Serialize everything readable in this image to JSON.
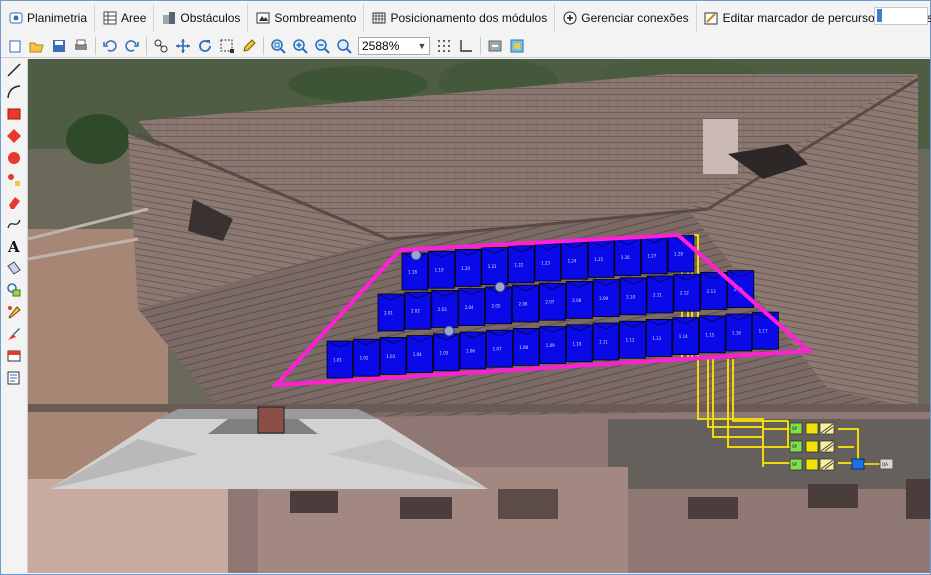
{
  "window": {
    "accent": "#6b9bd1"
  },
  "tabs": [
    {
      "label": "Planimetria",
      "icon": "planimetry-icon"
    },
    {
      "label": "Aree",
      "icon": "areas-icon"
    },
    {
      "label": "Obstáculos",
      "icon": "obstacles-icon"
    },
    {
      "label": "Sombreamento",
      "icon": "shading-icon"
    },
    {
      "label": "Posicionamento dos módulos",
      "icon": "modules-grid-icon"
    },
    {
      "label": "Gerenciar conexões",
      "icon": "add-circle-icon"
    },
    {
      "label": "Editar marcador de percurso dos cabos",
      "icon": "cable-path-icon"
    }
  ],
  "toolbar": {
    "zoom_value": "2588%",
    "buttons": [
      "new-icon",
      "open-icon",
      "save-icon",
      "print-icon",
      "undo-icon",
      "redo-icon",
      "select-nodes-icon",
      "move-icon",
      "rotate-icon",
      "select-area-icon",
      "pencil-icon",
      "zoom-fit-icon",
      "zoom-in-icon",
      "zoom-out-icon",
      "zoom-window-icon",
      "snap-grid-icon",
      "ortho-icon",
      "export-icon",
      "import-icon"
    ]
  },
  "left_tools": [
    "line-icon",
    "arc-icon",
    "rectangle-icon",
    "polygon-icon",
    "circle-icon",
    "points-icon",
    "eraser-icon",
    "curve-icon",
    "text-icon",
    "measure-icon",
    "layers-icon",
    "properties-icon",
    "draw-tool-icon",
    "image-icon",
    "notes-icon"
  ],
  "colors": {
    "roof_area": "#ff1fd6",
    "modules": "#0a0ae8",
    "cables": "#ffe600",
    "roof_tile": "#8a7770"
  },
  "modules": {
    "row1": [
      "1.18",
      "1.19",
      "1.20",
      "1.21",
      "1.22",
      "1.23",
      "1.24",
      "1.25",
      "1.26",
      "1.27",
      "1.28"
    ],
    "row2": [
      "2.01",
      "2.02",
      "2.03",
      "2.04",
      "2.05",
      "2.06",
      "2.07",
      "2.08",
      "2.09",
      "2.10",
      "2.11",
      "2.12",
      "2.13",
      "2.14"
    ],
    "row3": [
      "1.01",
      "1.02",
      "1.03",
      "1.04",
      "1.05",
      "1.06",
      "1.07",
      "1.08",
      "1.09",
      "1.10",
      "1.11",
      "1.12",
      "1.13",
      "1.14",
      "1.15",
      "1.16",
      "1.17"
    ]
  },
  "inverter_labels": [
    "SP",
    "SP",
    "SP"
  ],
  "output_label": "QA"
}
